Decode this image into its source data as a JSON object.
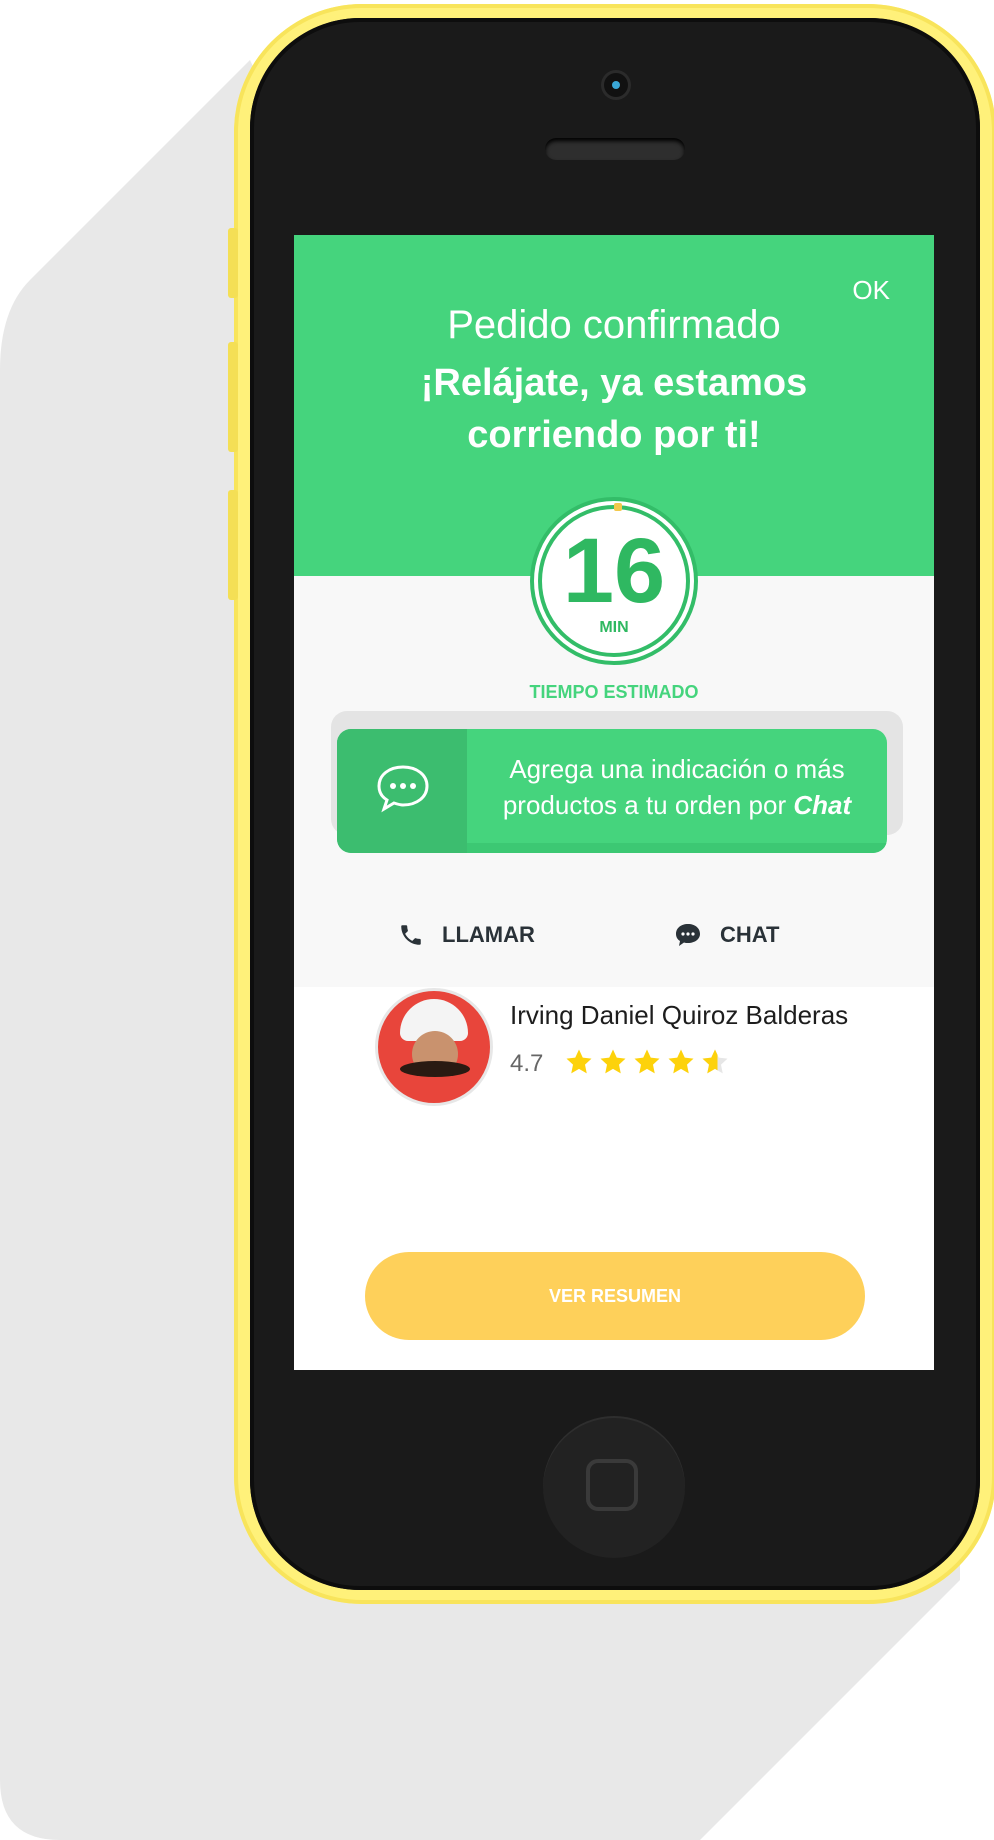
{
  "header": {
    "ok_label": "OK",
    "title": "Pedido confirmado",
    "subtitle": "¡Relájate, ya estamos corriendo por ti!"
  },
  "timer": {
    "value": "16",
    "unit": "MIN",
    "label": "TIEMPO ESTIMADO"
  },
  "chat_banner": {
    "text": "Agrega una indicación o más productos a tu orden por",
    "emphasis": "Chat",
    "icon": "chat-bubbles-icon"
  },
  "actions": {
    "call_label": "LLAMAR",
    "call_icon": "phone-icon",
    "chat_label": "CHAT",
    "chat_icon": "chat-bubble-icon"
  },
  "courier": {
    "name": "Irving Daniel Quiroz Balderas",
    "rating": "4.7",
    "stars_filled": 4.7,
    "stars_total": 5
  },
  "cta": {
    "label": "VER RESUMEN"
  },
  "colors": {
    "primary_green": "#45d47d",
    "dark_green": "#3cbd6f",
    "accent_yellow": "#fed05a",
    "star_yellow": "#fdd20b",
    "phone_shell": "#fff17a"
  }
}
